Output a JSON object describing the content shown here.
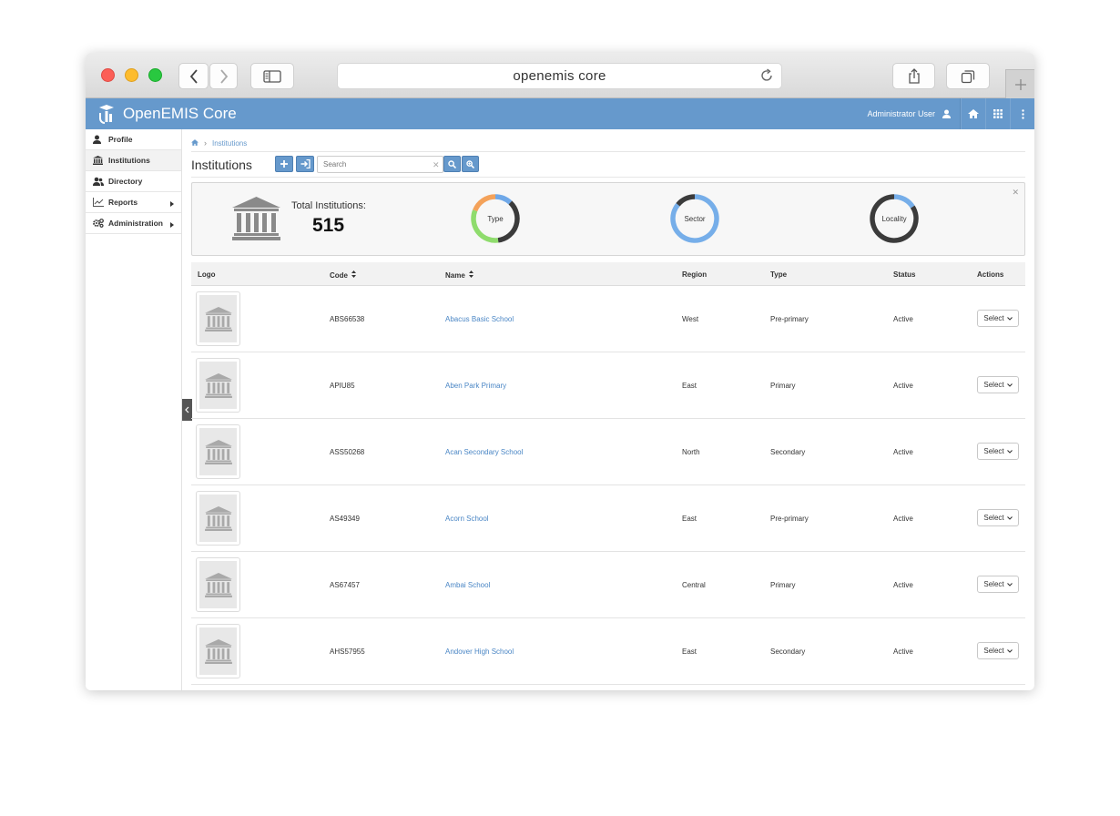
{
  "browser": {
    "url": "openemis core"
  },
  "app": {
    "brand": "OpenEMIS Core",
    "user": "Administrator User",
    "colors": {
      "header": "#6699cc",
      "link": "#4a86c5"
    }
  },
  "sidebar": {
    "items": [
      {
        "label": "Profile",
        "icon": "user-icon"
      },
      {
        "label": "Institutions",
        "icon": "institution-icon"
      },
      {
        "label": "Directory",
        "icon": "users-icon"
      },
      {
        "label": "Reports",
        "icon": "chart-icon"
      },
      {
        "label": "Administration",
        "icon": "cogs-icon"
      }
    ]
  },
  "breadcrumb": {
    "current": "Institutions"
  },
  "page": {
    "title": "Institutions",
    "search_placeholder": "Search"
  },
  "summary": {
    "total_label": "Total Institutions:",
    "total_value": "515",
    "donuts": [
      {
        "label": "Type",
        "segments": [
          {
            "value": 0.12,
            "color": "#6fa8e8"
          },
          {
            "value": 0.36,
            "color": "#3b3b3b"
          },
          {
            "value": 0.33,
            "color": "#8fdc6d"
          },
          {
            "value": 0.19,
            "color": "#f4a25a"
          }
        ]
      },
      {
        "label": "Sector",
        "segments": [
          {
            "value": 0.86,
            "color": "#76aee9"
          },
          {
            "value": 0.14,
            "color": "#3b3b3b"
          }
        ]
      },
      {
        "label": "Locality",
        "segments": [
          {
            "value": 0.16,
            "color": "#76aee9"
          },
          {
            "value": 0.84,
            "color": "#3b3b3b"
          }
        ]
      }
    ]
  },
  "table": {
    "headers": {
      "logo": "Logo",
      "code": "Code",
      "name": "Name",
      "region": "Region",
      "type": "Type",
      "status": "Status",
      "actions": "Actions"
    },
    "select_label": "Select",
    "rows": [
      {
        "code": "ABS66538",
        "name": "Abacus Basic School",
        "region": "West",
        "type": "Pre-primary",
        "status": "Active"
      },
      {
        "code": "APIU85",
        "name": "Aben Park Primary",
        "region": "East",
        "type": "Primary",
        "status": "Active"
      },
      {
        "code": "ASS50268",
        "name": "Acan Secondary School",
        "region": "North",
        "type": "Secondary",
        "status": "Active"
      },
      {
        "code": "AS49349",
        "name": "Acorn School",
        "region": "East",
        "type": "Pre-primary",
        "status": "Active"
      },
      {
        "code": "AS67457",
        "name": "Ambai School",
        "region": "Central",
        "type": "Primary",
        "status": "Active"
      },
      {
        "code": "AHS57955",
        "name": "Andover High School",
        "region": "East",
        "type": "Secondary",
        "status": "Active"
      }
    ]
  }
}
